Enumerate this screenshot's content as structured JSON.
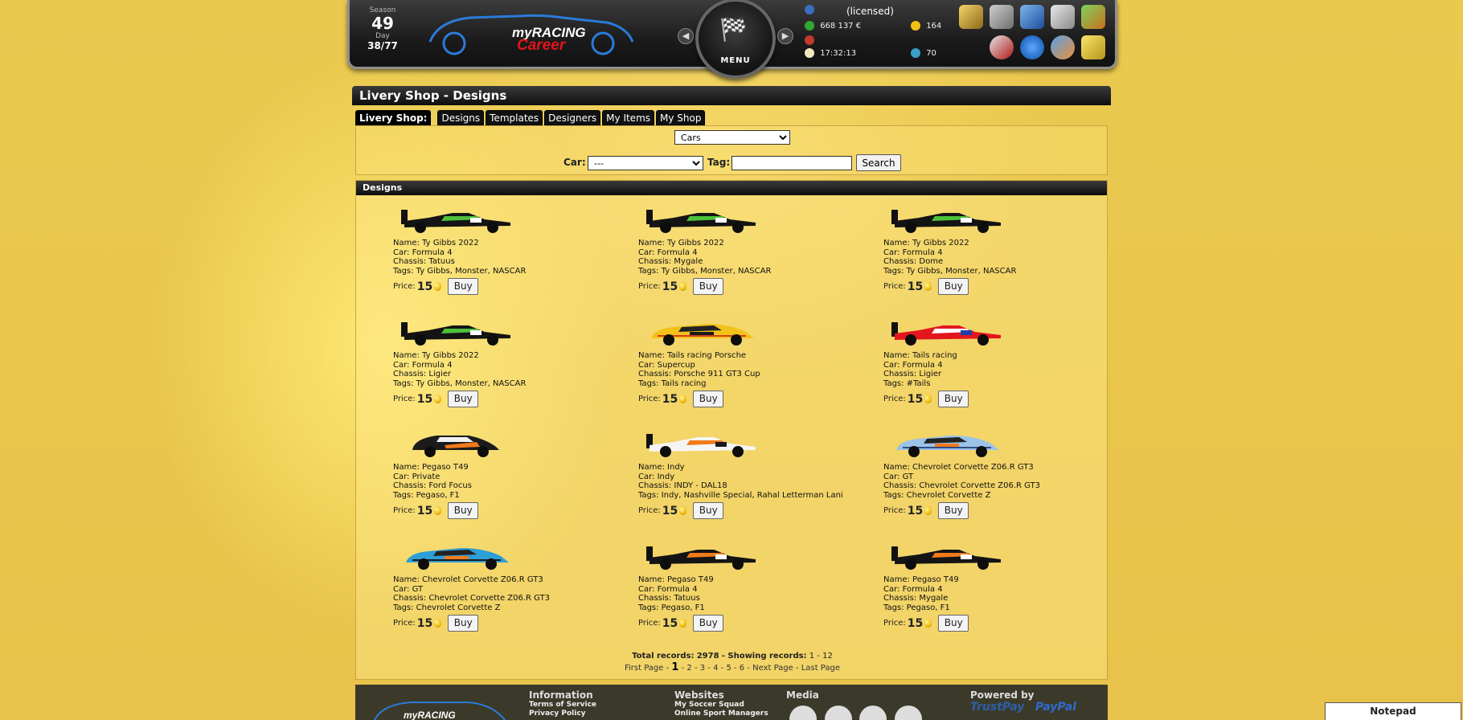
{
  "header": {
    "season_label": "Season",
    "season_value": "49",
    "day_label": "Day",
    "day_value": "38/77",
    "logo_text": "myRACING Career",
    "menu_label": "MENU",
    "licensed": "(licensed)",
    "money": "668 137 €",
    "coins": "164",
    "time": "17:32:13",
    "points": "70"
  },
  "page": {
    "title": "Livery Shop - Designs"
  },
  "tabs": {
    "label": "Livery Shop:",
    "items": [
      "Designs",
      "Templates",
      "Designers",
      "My Items",
      "My Shop"
    ]
  },
  "filters": {
    "type_selected": "Cars",
    "car_label": "Car:",
    "car_selected": "---",
    "tag_label": "Tag:",
    "tag_value": "",
    "search_label": "Search"
  },
  "designs": {
    "heading": "Designs",
    "price_label": "Price:",
    "buy_label": "Buy",
    "items": [
      {
        "name": "Name: Ty Gibbs 2022",
        "car": "Car: Formula 4",
        "chassis": "Chassis: Tatuus",
        "tags": "Tags: Ty Gibbs, Monster, NASCAR",
        "price": "15",
        "livery": "formula-black-monster"
      },
      {
        "name": "Name: Ty Gibbs 2022",
        "car": "Car: Formula 4",
        "chassis": "Chassis: Mygale",
        "tags": "Tags: Ty Gibbs, Monster, NASCAR",
        "price": "15",
        "livery": "formula-black-monster"
      },
      {
        "name": "Name: Ty Gibbs 2022",
        "car": "Car: Formula 4",
        "chassis": "Chassis: Dome",
        "tags": "Tags: Ty Gibbs, Monster, NASCAR",
        "price": "15",
        "livery": "formula-black-monster"
      },
      {
        "name": "Name: Ty Gibbs 2022",
        "car": "Car: Formula 4",
        "chassis": "Chassis: Ligier",
        "tags": "Tags: Ty Gibbs, Monster, NASCAR",
        "price": "15",
        "livery": "formula-black-monster"
      },
      {
        "name": "Name: Tails racing Porsche",
        "car": "Car: Supercup",
        "chassis": "Chassis: Porsche 911 GT3 Cup",
        "tags": "Tags: Tails racing",
        "price": "15",
        "livery": "porsche-yellow"
      },
      {
        "name": "Name: Tails racing",
        "car": "Car: Formula 4",
        "chassis": "Chassis: Ligier",
        "tags": "Tags: #Tails",
        "price": "15",
        "livery": "formula-red"
      },
      {
        "name": "Name: Pegaso T49",
        "car": "Car: Private",
        "chassis": "Chassis: Ford Focus",
        "tags": "Tags: Pegaso, F1",
        "price": "15",
        "livery": "focus-black-orange"
      },
      {
        "name": "Name: Indy",
        "car": "Car: Indy",
        "chassis": "Chassis: INDY - DAL18",
        "tags": "Tags: Indy, Nashville Special, Rahal Letterman Lani",
        "price": "15",
        "livery": "indy-white-orange"
      },
      {
        "name": "Name: Chevrolet Corvette Z06.R GT3",
        "car": "Car: GT",
        "chassis": "Chassis: Chevrolet Corvette Z06.R GT3",
        "tags": "Tags: Chevrolet Corvette Z",
        "price": "15",
        "livery": "gt-light-blue"
      },
      {
        "name": "Name: Chevrolet Corvette Z06.R GT3",
        "car": "Car: GT",
        "chassis": "Chassis: Chevrolet Corvette Z06.R GT3",
        "tags": "Tags: Chevrolet Corvette Z",
        "price": "15",
        "livery": "gt-cyan"
      },
      {
        "name": "Name: Pegaso T49",
        "car": "Car: Formula 4",
        "chassis": "Chassis: Tatuus",
        "tags": "Tags: Pegaso, F1",
        "price": "15",
        "livery": "formula-black-orange"
      },
      {
        "name": "Name: Pegaso T49",
        "car": "Car: Formula 4",
        "chassis": "Chassis: Mygale",
        "tags": "Tags: Pegaso, F1",
        "price": "15",
        "livery": "formula-black-orange"
      }
    ]
  },
  "pagination": {
    "total_label": "Total records:",
    "total_value": "2978",
    "showing_label": "- Showing records:",
    "showing_value": "1 - 12",
    "first": "First Page",
    "pages": [
      "1",
      "2",
      "3",
      "4",
      "5",
      "6"
    ],
    "next": "Next Page",
    "last": "Last Page"
  },
  "footer": {
    "information": "Information",
    "info_links": [
      "Terms of Service",
      "Privacy Policy"
    ],
    "websites": "Websites",
    "web_links": [
      "My Soccer Squad",
      "Online Sport Managers"
    ],
    "media": "Media",
    "powered_by": "Powered by",
    "trustpay": "TrustPay",
    "paypal": "PayPal"
  },
  "notepad": "Notepad",
  "colors": {
    "page_bg": "#e9c64e",
    "bar_dark": "#111111",
    "footer_bg": "#3b3a2a",
    "coin": "#f1c111"
  }
}
